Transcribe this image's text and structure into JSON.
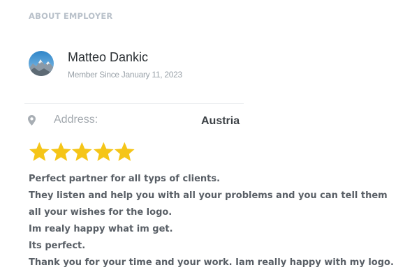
{
  "section": {
    "title": "ABOUT EMPLOYER"
  },
  "employer": {
    "name": "Matteo Dankic",
    "member_since": "Member Since January 11, 2023"
  },
  "address": {
    "label": "Address:",
    "value": "Austria"
  },
  "rating": {
    "stars": 5,
    "max": 5,
    "star_color": "#f5c518"
  },
  "review": {
    "lines": [
      "Perfect partner for all typs of clients.",
      "They listen and help you with all your problems and you can tell them",
      "all your wishes for the logo.",
      "Im realy happy what im get.",
      "Its perfect.",
      "Thank you for your time and your work. Iam really happy with my logo."
    ]
  },
  "icons": {
    "address": "map-pin-icon"
  }
}
